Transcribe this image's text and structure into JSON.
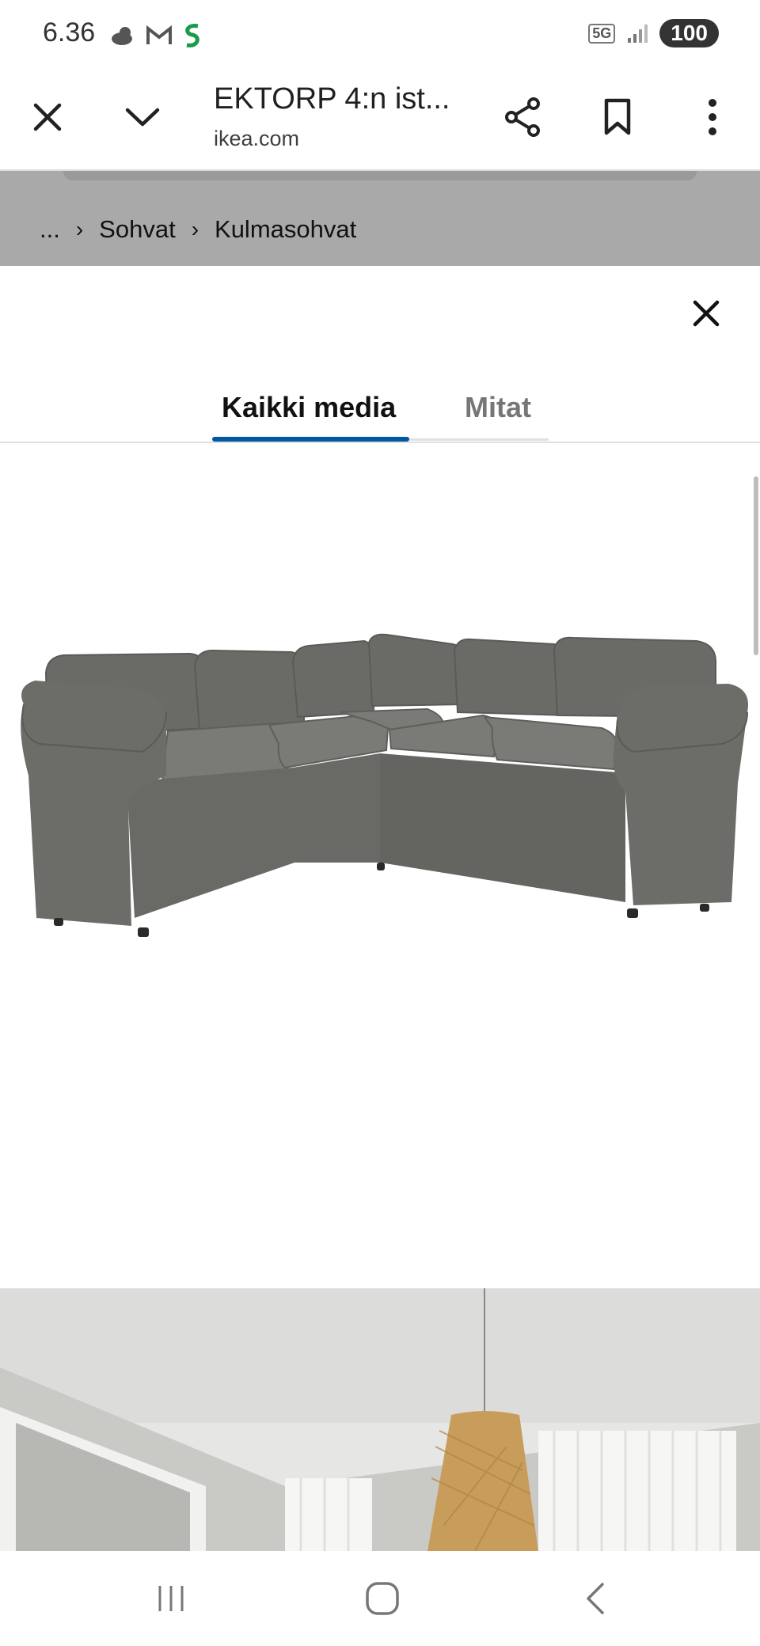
{
  "status_bar": {
    "time": "6.36",
    "network": "5G",
    "battery": "100"
  },
  "toolbar": {
    "title": "EKTORP 4:n ist...",
    "url": "ikea.com"
  },
  "breadcrumb": {
    "ellipsis": "...",
    "items": [
      "Sohvat",
      "Kulmasohvat"
    ]
  },
  "media_sheet": {
    "tabs": [
      {
        "label": "Kaikki media",
        "active": true
      },
      {
        "label": "Mitat",
        "active": false
      }
    ]
  },
  "colors": {
    "accent": "#0058a3",
    "sofa": "#6e6f6b",
    "backdrop": "#a9a9a9"
  }
}
